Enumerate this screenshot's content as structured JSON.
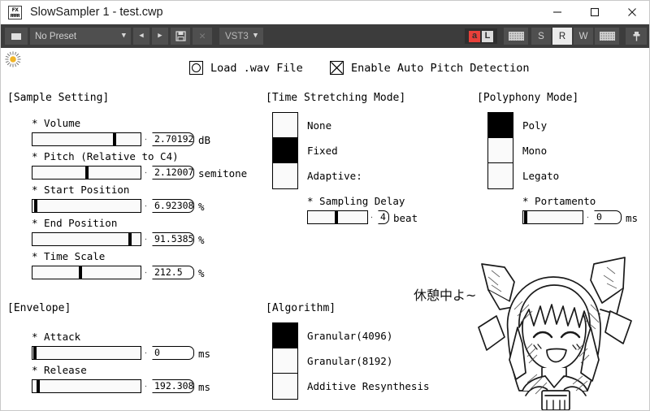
{
  "window": {
    "title": "SlowSampler 1 - test.cwp",
    "app_icon": "fx-plugin-icon",
    "minimize_label": "Minimize",
    "maximize_label": "Maximize",
    "close_label": "Close"
  },
  "toolbar": {
    "menu_button_label": "",
    "preset_value": "No Preset",
    "preset_caret": "▼",
    "prev_label": "◀",
    "next_label": "▶",
    "save_label": "",
    "delete_label": "✕",
    "format_label": "VST3",
    "format_caret": "▼",
    "automation_a": "a",
    "automation_l": "L",
    "transport": [
      {
        "label": "S",
        "active": false
      },
      {
        "label": "R",
        "active": true
      },
      {
        "label": "W",
        "active": false
      }
    ]
  },
  "panel": {
    "plugin_icon_name": "flower-icon",
    "checkboxes": [
      {
        "name": "load-wav-file",
        "label": "Load .wav File",
        "type": "circle",
        "checked": false
      },
      {
        "name": "enable-auto-pitch-detection",
        "label": "Enable Auto Pitch Detection",
        "type": "cross",
        "checked": true
      }
    ],
    "sample_setting": {
      "title": "[Sample Setting]",
      "params": [
        {
          "label": "* Volume",
          "value": "2.70192",
          "unit": "dB",
          "fill": 0.76
        },
        {
          "label": "* Pitch (Relative to C4)",
          "value": "2.12007",
          "unit": "semitone",
          "fill": 0.5
        },
        {
          "label": "* Start Position",
          "value": "6.92308",
          "unit": "%",
          "fill": 0.025
        },
        {
          "label": "* End Position",
          "value": "91.5385",
          "unit": "%",
          "fill": 0.905
        },
        {
          "label": "* Time Scale",
          "value": "212.5",
          "unit": "%",
          "fill": 0.43
        }
      ]
    },
    "envelope": {
      "title": "[Envelope]",
      "params": [
        {
          "label": "* Attack",
          "value": "0",
          "unit": "ms",
          "fill": 0.01
        },
        {
          "label": "* Release",
          "value": "192.308",
          "unit": "ms",
          "fill": 0.045
        }
      ]
    },
    "time_stretching_mode": {
      "title": "[Time Stretching Mode]",
      "options": [
        {
          "label": "None",
          "selected": false
        },
        {
          "label": "Fixed",
          "selected": true
        },
        {
          "label": "Adaptive:",
          "selected": false
        }
      ],
      "sub_param": {
        "label": "* Sampling Delay",
        "value": "4",
        "unit": "beat",
        "fill": 0.4
      }
    },
    "polyphony_mode": {
      "title": "[Polyphony Mode]",
      "options": [
        {
          "label": "Poly",
          "selected": true
        },
        {
          "label": "Mono",
          "selected": false
        },
        {
          "label": "Legato",
          "selected": false
        }
      ],
      "sub_param": {
        "label": "* Portamento",
        "value": "0",
        "unit": "ms",
        "fill": 0.03
      }
    },
    "algorithm": {
      "title": "[Algorithm]",
      "options": [
        {
          "label": "Granular(4096)",
          "selected": true
        },
        {
          "label": "Granular(8192)",
          "selected": false
        },
        {
          "label": "Additive Resynthesis",
          "selected": false
        }
      ]
    },
    "character": {
      "speech_text": "休憩中よ~",
      "art_name": "manga-girl-illustration"
    }
  },
  "colors": {
    "titlebar_bg": "#ffffff",
    "toolbar_bg": "#3c3c3c",
    "toolbar_btn": "#4f4f4f",
    "accent_red": "#e8403a",
    "active_btn": "#ebebeb",
    "panel_bg": "#ffffff",
    "ink": "#000000",
    "flower_center": "#f0b428"
  }
}
